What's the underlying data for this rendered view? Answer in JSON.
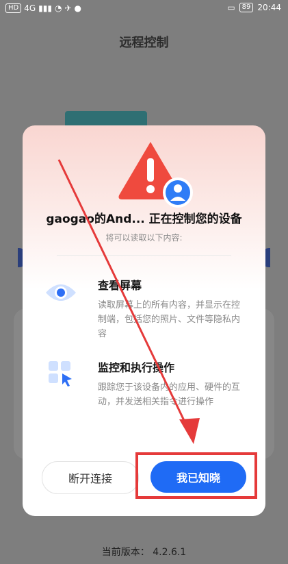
{
  "status_bar": {
    "network": "4G",
    "battery": "89",
    "time": "20:44"
  },
  "app": {
    "title": "远程控制",
    "version_label": "当前版本：",
    "version": "4.2.6.1"
  },
  "dialog": {
    "title": "gaogao的And... 正在控制您的设备",
    "subtitle": "将可以读取以下内容:",
    "permissions": [
      {
        "icon": "eye-icon",
        "title": "查看屏幕",
        "desc": "读取屏幕上的所有内容，并显示在控制端，包括您的照片、文件等隐私内容"
      },
      {
        "icon": "grid-pointer-icon",
        "title": "监控和执行操作",
        "desc": "跟踪您于该设备内的应用、硬件的互动，并发送相关指令进行操作"
      }
    ],
    "buttons": {
      "disconnect": "断开连接",
      "ok": "我已知晓"
    }
  },
  "colors": {
    "accent": "#1f6bf5",
    "warning": "#ef4a3e",
    "annotation": "#e53a3a"
  }
}
